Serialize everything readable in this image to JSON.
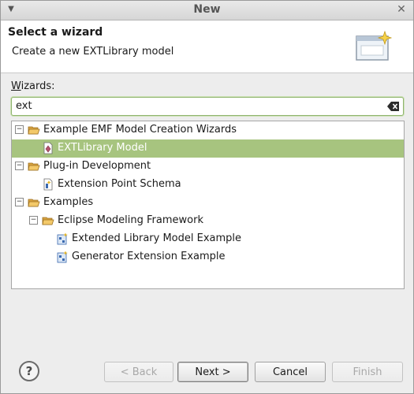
{
  "window": {
    "title": "New"
  },
  "header": {
    "title": "Select a wizard",
    "description": "Create a new EXTLibrary model"
  },
  "wizards_label_prefix": "W",
  "wizards_label_rest": "izards:",
  "filter": {
    "value": "ext"
  },
  "tree": [
    {
      "label": "Example EMF Model Creation Wizards",
      "icon": "folder-open-icon",
      "expander": "−"
    },
    {
      "label": "EXTLibrary Model",
      "icon": "model-wizard-icon"
    },
    {
      "label": "Plug-in Development",
      "icon": "folder-open-icon",
      "expander": "−"
    },
    {
      "label": "Extension Point Schema",
      "icon": "schema-icon"
    },
    {
      "label": "Examples",
      "icon": "folder-open-icon",
      "expander": "−"
    },
    {
      "label": "Eclipse Modeling Framework",
      "icon": "folder-open-icon",
      "expander": "−"
    },
    {
      "label": "Extended Library Model Example",
      "icon": "example-icon"
    },
    {
      "label": "Generator Extension Example",
      "icon": "example-icon"
    }
  ],
  "buttons": {
    "help": "?",
    "back": "< Back",
    "next": "Next >",
    "cancel": "Cancel",
    "finish": "Finish"
  },
  "colors": {
    "selection": "#a7c47f",
    "focus_border": "#8fb46f"
  }
}
